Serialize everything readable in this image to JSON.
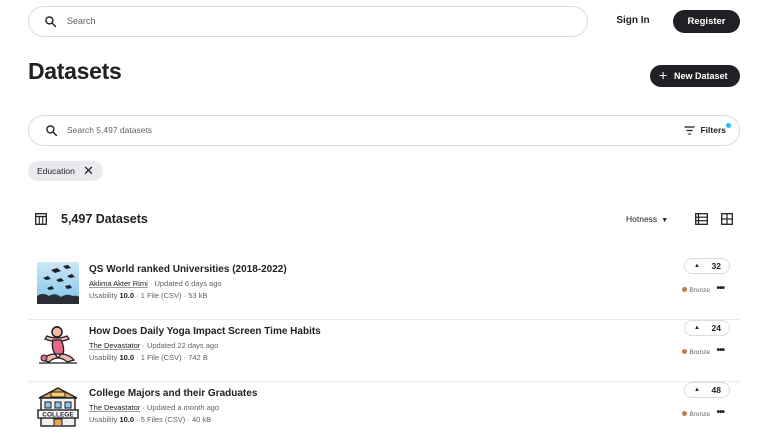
{
  "header": {
    "search_placeholder": "Search",
    "sign_in": "Sign In",
    "register": "Register"
  },
  "page": {
    "title": "Datasets",
    "new_dataset": "New Dataset"
  },
  "dataset_search": {
    "placeholder": "Search 5,497 datasets",
    "filters_label": "Filters"
  },
  "active_filter": {
    "label": "Education"
  },
  "results": {
    "count_label": "5,497 Datasets",
    "sort_label": "Hotness"
  },
  "datasets": [
    {
      "title": "QS World ranked Universities (2018-2022)",
      "author": "Aklima Akter Rimi",
      "updated": "· Updated 6 days ago",
      "usability_prefix": "Usability ",
      "usability": "10.0",
      "details": " · 1 File (CSV) · 53 kB",
      "votes": "32",
      "medal": "Bronze",
      "thumb_icon": "graduation-caps-icon"
    },
    {
      "title": "How Does Daily Yoga Impact Screen Time Habits",
      "author": "The Devastator",
      "updated": "· Updated 22 days ago",
      "usability_prefix": "Usability ",
      "usability": "10.0",
      "details": " · 1 File (CSV) · 742 B",
      "votes": "24",
      "medal": "Bronze",
      "thumb_icon": "yoga-pose-icon"
    },
    {
      "title": "College Majors and their Graduates",
      "author": "The Devastator",
      "updated": "· Updated a month ago",
      "usability_prefix": "Usability ",
      "usability": "10.0",
      "details": " · 5 Files (CSV) · 40 kB",
      "votes": "48",
      "medal": "Bronze",
      "thumb_icon": "college-building-icon"
    }
  ],
  "colors": {
    "primary_dark": "#202124",
    "border": "#dadce0",
    "filter_dot": "#20beff",
    "bronze": "#c07b4a"
  }
}
